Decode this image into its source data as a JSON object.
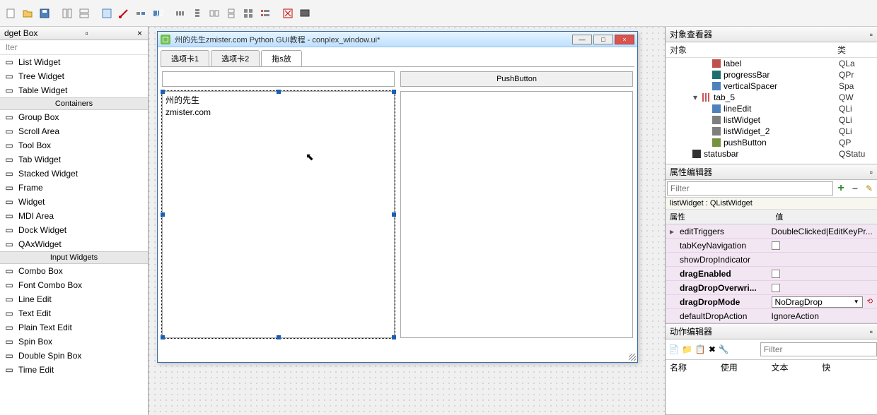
{
  "toolbar_icons": [
    "new",
    "open",
    "save",
    "sep",
    "copy",
    "paste",
    "sep",
    "align-left",
    "select",
    "cut",
    "box",
    "number",
    "sep",
    "hsplit",
    "vsplit",
    "hbox",
    "vbox",
    "grid",
    "form",
    "sep",
    "break-layout",
    "preview"
  ],
  "left": {
    "title": "dget Box",
    "filter_placeholder": "lter",
    "sections": [
      {
        "items": [
          {
            "label": "List Widget",
            "icon": "list"
          },
          {
            "label": "Tree Widget",
            "icon": "tree"
          },
          {
            "label": "Table Widget",
            "icon": "table"
          }
        ]
      },
      {
        "header": "Containers",
        "items": [
          {
            "label": "Group Box",
            "icon": "group"
          },
          {
            "label": "Scroll Area",
            "icon": "scroll"
          },
          {
            "label": "Tool Box",
            "icon": "toolbox"
          },
          {
            "label": "Tab Widget",
            "icon": "tab"
          },
          {
            "label": "Stacked Widget",
            "icon": "stack"
          },
          {
            "label": "Frame",
            "icon": "frame"
          },
          {
            "label": "Widget",
            "icon": "widget"
          },
          {
            "label": "MDI Area",
            "icon": "mdi"
          },
          {
            "label": "Dock Widget",
            "icon": "dock"
          },
          {
            "label": "QAxWidget",
            "icon": "ax"
          }
        ]
      },
      {
        "header": "Input Widgets",
        "items": [
          {
            "label": "Combo Box",
            "icon": "combo"
          },
          {
            "label": "Font Combo Box",
            "icon": "fontcombo"
          },
          {
            "label": "Line Edit",
            "icon": "lineedit"
          },
          {
            "label": "Text Edit",
            "icon": "textedit"
          },
          {
            "label": "Plain Text Edit",
            "icon": "plaintext"
          },
          {
            "label": "Spin Box",
            "icon": "spin"
          },
          {
            "label": "Double Spin Box",
            "icon": "dspin"
          },
          {
            "label": "Time Edit",
            "icon": "time"
          }
        ]
      }
    ]
  },
  "window": {
    "title": "州的先生zmister.com Python GUI教程 - conplex_window.ui*",
    "min": "—",
    "max": "□",
    "close": "×",
    "tabs": [
      "选项卡1",
      "选项卡2",
      "拖s放"
    ],
    "active_tab": 2,
    "pushbutton": "PushButton",
    "list_items": [
      "州的先生",
      "zmister.com"
    ]
  },
  "inspector": {
    "title": "对象查看器",
    "col_obj": "对象",
    "col_class": "类",
    "rows": [
      {
        "indent": 3,
        "label": "label",
        "cls": "QLa",
        "icon": "red"
      },
      {
        "indent": 3,
        "label": "progressBar",
        "cls": "QPr",
        "icon": "teal"
      },
      {
        "indent": 3,
        "label": "verticalSpacer",
        "cls": "Spa",
        "icon": "blue"
      },
      {
        "indent": 2,
        "expand": "▾",
        "label": "tab_5",
        "cls": "QW",
        "icon": "grid"
      },
      {
        "indent": 3,
        "label": "lineEdit",
        "cls": "QLi",
        "icon": "blue"
      },
      {
        "indent": 3,
        "label": "listWidget",
        "cls": "QLi",
        "icon": "gray"
      },
      {
        "indent": 3,
        "label": "listWidget_2",
        "cls": "QLi",
        "icon": "gray"
      },
      {
        "indent": 3,
        "label": "pushButton",
        "cls": "QP",
        "icon": "green"
      },
      {
        "indent": 1,
        "label": "statusbar",
        "cls": "QStatu",
        "icon": "dk"
      }
    ]
  },
  "props": {
    "title": "属性编辑器",
    "filter_placeholder": "Filter",
    "class_line": "listWidget : QListWidget",
    "head_prop": "属性",
    "head_val": "值",
    "rows": [
      {
        "name": "editTriggers",
        "value": "DoubleClicked|EditKeyPr...",
        "expand": true
      },
      {
        "name": "tabKeyNavigation",
        "checkbox": true
      },
      {
        "name": "showDropIndicator"
      },
      {
        "name": "dragEnabled",
        "checkbox": true,
        "bold": true
      },
      {
        "name": "dragDropOverwri...",
        "checkbox": true,
        "bold": true
      },
      {
        "name": "dragDropMode",
        "combo": "NoDragDrop",
        "bold": true,
        "revert": true
      },
      {
        "name": "defaultDropAction",
        "value": "IgnoreAction"
      }
    ]
  },
  "actions": {
    "title": "动作编辑器",
    "filter_placeholder": "Filter",
    "cols": [
      "名称",
      "使用",
      "文本",
      "快"
    ]
  }
}
